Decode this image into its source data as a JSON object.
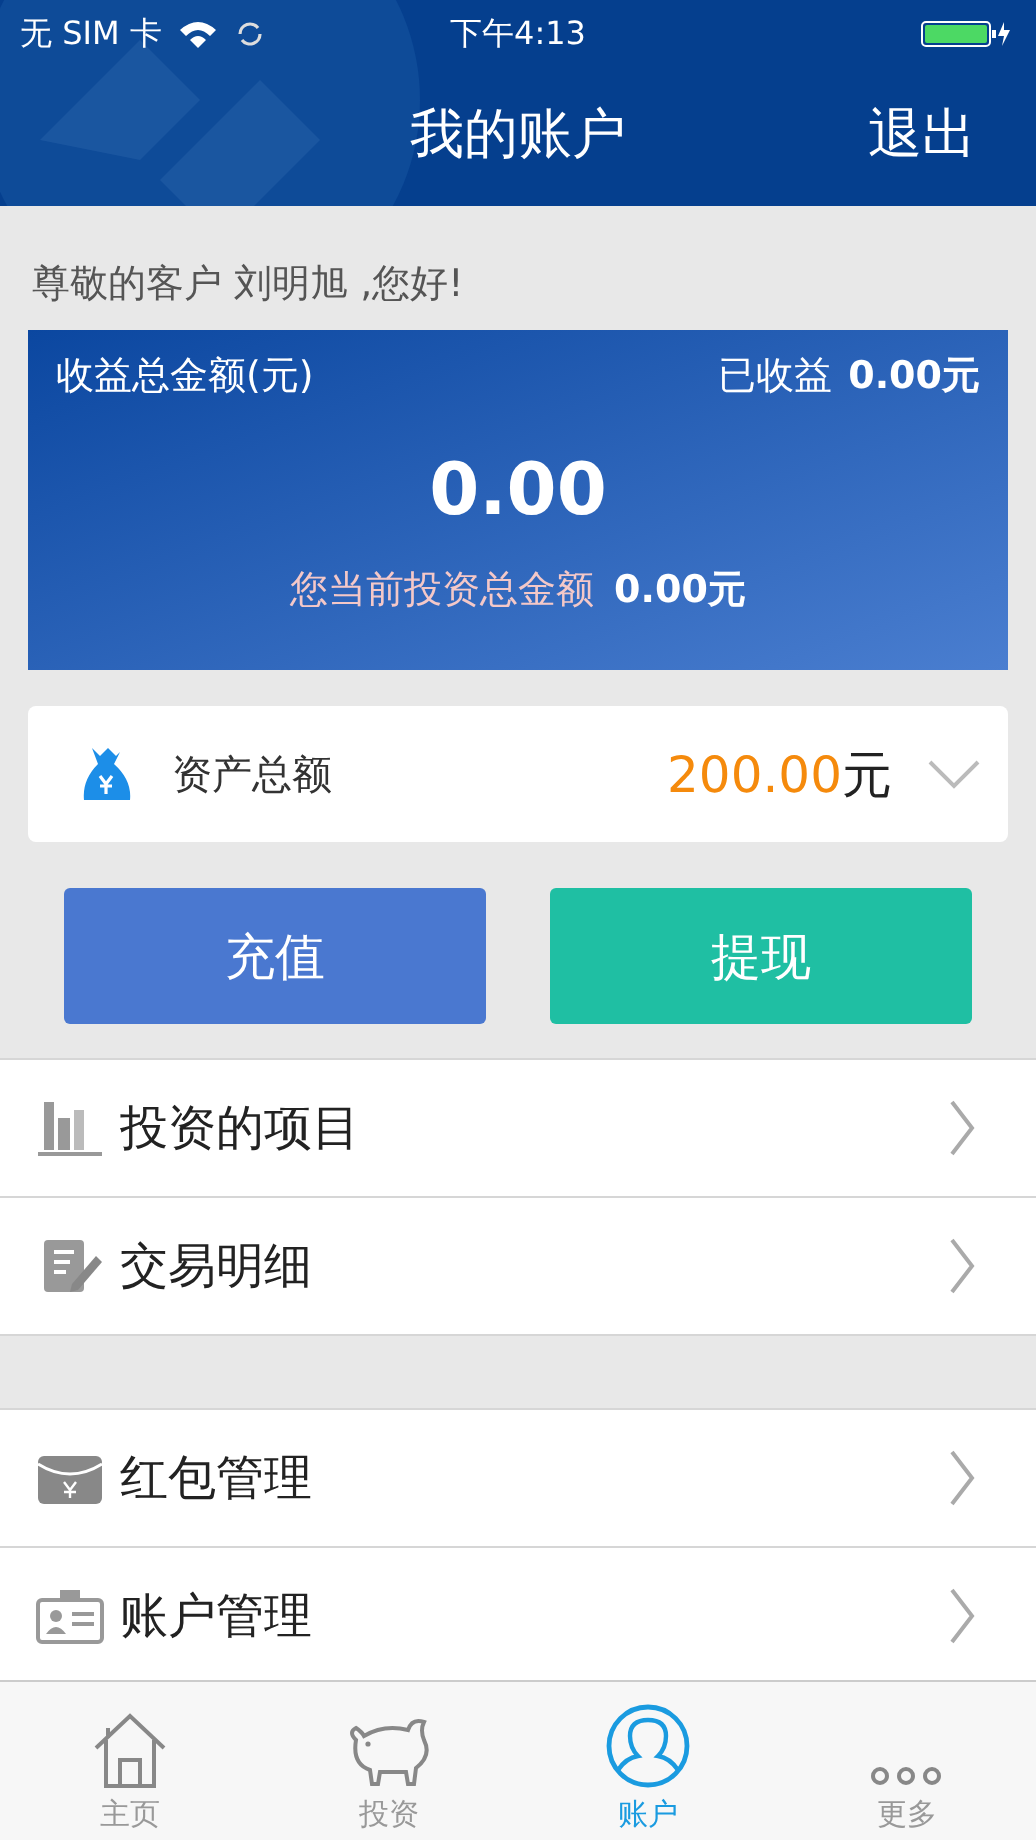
{
  "status_bar": {
    "carrier": "无 SIM 卡",
    "time": "下午4:13"
  },
  "nav": {
    "title": "我的账户",
    "action": "退出"
  },
  "greeting": "尊敬的客户 刘明旭 ,您好!",
  "summary": {
    "label": "收益总金额(元)",
    "earned_label": "已收益",
    "earned_value": "0.00元",
    "total": "0.00",
    "invested_label": "您当前投资总金额",
    "invested_value": "0.00元"
  },
  "assets": {
    "label": "资产总额",
    "amount": "200.00",
    "unit": "元",
    "expanded": false
  },
  "buttons": [
    {
      "label": "充值",
      "kind": "recharge"
    },
    {
      "label": "提现",
      "kind": "withdraw"
    }
  ],
  "menu_groups": [
    [
      {
        "label": "投资的项目",
        "kind": "buildings"
      },
      {
        "label": "交易明细",
        "kind": "notebook"
      }
    ],
    [
      {
        "label": "红包管理",
        "kind": "envelope"
      },
      {
        "label": "账户管理",
        "kind": "idcard"
      }
    ]
  ],
  "tabs": [
    {
      "label": "主页",
      "kind": "home",
      "selected": false
    },
    {
      "label": "投资",
      "kind": "piggy",
      "selected": false
    },
    {
      "label": "账户",
      "kind": "user",
      "selected": true
    },
    {
      "label": "更多",
      "kind": "more",
      "selected": false
    }
  ]
}
